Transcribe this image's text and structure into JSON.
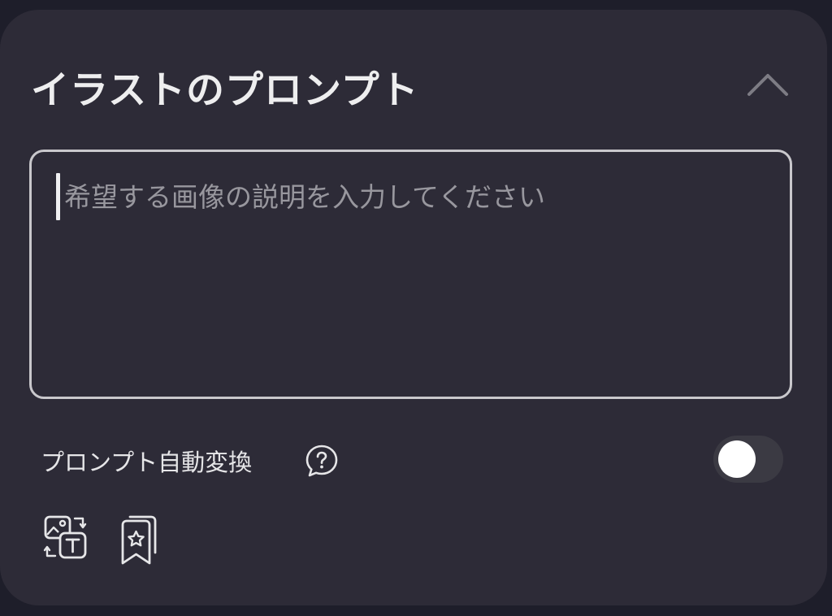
{
  "panel": {
    "title": "イラストのプロンプト",
    "collapse_icon": "chevron-up-icon"
  },
  "prompt": {
    "placeholder": "希望する画像の説明を入力してください",
    "value": ""
  },
  "auto_convert": {
    "label": "プロンプト自動変換",
    "help_icon": "question-bubble-icon",
    "enabled": false
  },
  "toolbar": {
    "icons": [
      "image-to-text-icon",
      "bookmark-star-icon"
    ]
  },
  "colors": {
    "background": "#1e1e2a",
    "card": "#2d2b37",
    "text": "#eeeeef",
    "placeholder": "#98979e",
    "border": "#c9c8cc",
    "toggle_track": "#3b3a43",
    "toggle_knob": "#ffffff"
  }
}
